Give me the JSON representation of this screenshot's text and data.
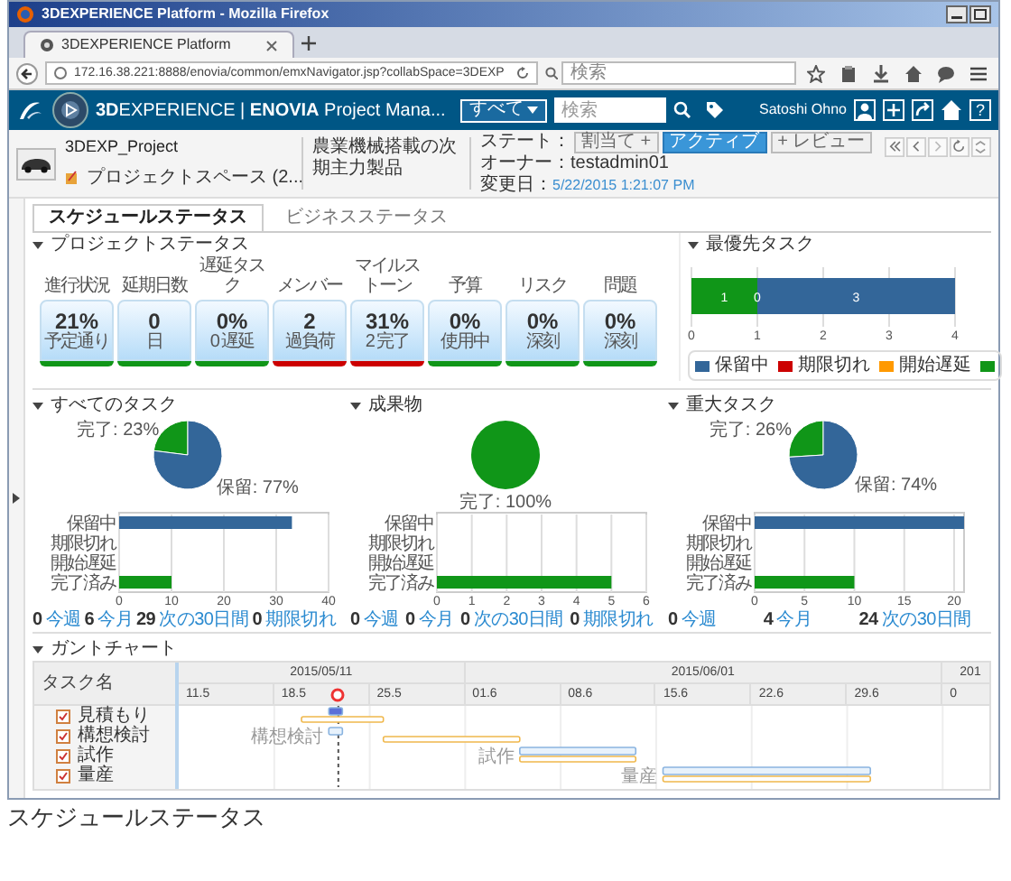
{
  "browser": {
    "title": "3DEXPERIENCE Platform - Mozilla Firefox",
    "tab": "3DEXPERIENCE Platform",
    "url": "172.16.38.221:8888/enovia/common/emxNavigator.jsp?collabSpace=3DEXP",
    "search_placeholder": "検索"
  },
  "app_bar": {
    "title": "**3D**EXPERIENCE | **ENOVIA** Project Mana...",
    "scope": "すべて",
    "search_placeholder": "検索",
    "user": "Satoshi Ohno",
    "help": "?"
  },
  "header": {
    "name": "3DEXP_Project",
    "type": "プロジェクトスペース (2...",
    "description": "農業機械搭載の次期主力製品",
    "state_label": "ステート：",
    "states": [
      {
        "label": "割当て +",
        "selected": false
      },
      {
        "label": "アクティブ",
        "selected": true
      },
      {
        "label": "+ レビュー",
        "selected": false
      }
    ],
    "owner": "オーナー：testadmin01",
    "modified_label": "変更日：",
    "modified": "5/22/2015 1:21:07 PM"
  },
  "tabs": [
    {
      "label": "スケジュールステータス",
      "selected": true
    },
    {
      "label": "ビジネスステータス",
      "selected": false
    }
  ],
  "project_status": {
    "title": "プロジェクトステータス",
    "cards": [
      {
        "label": "進行状況",
        "value": "21%",
        "note": "予定通り",
        "color": "#109618"
      },
      {
        "label": "延期日数",
        "value": "0",
        "note": "日",
        "color": "#109618"
      },
      {
        "label": "遅延タスク",
        "value": "0%",
        "note": "0 遅延",
        "color": "#109618"
      },
      {
        "label": "メンバー",
        "value": "2",
        "note": "過負荷",
        "color": "#cc0000"
      },
      {
        "label": "マイルストーン",
        "value": "31%",
        "note": "2 完了",
        "color": "#cc0000"
      },
      {
        "label": "予算",
        "value": "0%",
        "note": "使用中",
        "color": "#109618"
      },
      {
        "label": "リスク",
        "value": "0%",
        "note": "深刻",
        "color": "#109618"
      },
      {
        "label": "問題",
        "value": "0%",
        "note": "深刻",
        "color": "#109618"
      }
    ]
  },
  "top_tasks": {
    "title": "最優先タスク",
    "chart_data": {
      "type": "bar",
      "orientation": "horizontal",
      "stacked": true,
      "grid": true,
      "xlim": [
        0,
        4
      ],
      "xticks": [
        0,
        1,
        2,
        3,
        4
      ],
      "series": [
        {
          "name": "保留中",
          "color": "#336699",
          "values": [
            3
          ],
          "value_labels": [
            "3"
          ]
        },
        {
          "name": "期限切れ",
          "color": "#cc0000",
          "values": [
            null
          ]
        },
        {
          "name": "開始遅延",
          "color": "#ff9900",
          "values": [
            0
          ]
        },
        {
          "color": "#109618",
          "values": [
            1
          ],
          "value_labels": [
            "1"
          ]
        }
      ],
      "annotations": [
        {
          "x": 1,
          "text": "0"
        }
      ]
    }
  },
  "panels": [
    {
      "title": "すべてのタスク",
      "pie": {
        "chart_data": {
          "type": "pie",
          "values": [
            23,
            77
          ],
          "value_labels": [
            "完了: 23%",
            "保留: 77%"
          ]
        }
      },
      "bars": {
        "chart_data": {
          "type": "bar",
          "orientation": "horizontal",
          "grid": true,
          "categories": [
            "保留中",
            "期限切れ",
            "開始遅延",
            "完了済み"
          ],
          "values": [
            33,
            0,
            0,
            10
          ],
          "xlim": [
            0,
            40
          ],
          "xticks": [
            0,
            10,
            20,
            30,
            40
          ]
        }
      },
      "footer": [
        {
          "count": "0",
          "label": "今週"
        },
        {
          "count": "6",
          "label": "今月"
        },
        {
          "count": "29",
          "label": "次の30日間"
        },
        {
          "count": "0",
          "label": "期限切れ"
        }
      ]
    },
    {
      "title": "成果物",
      "pie": {
        "chart_data": {
          "type": "pie",
          "values": [
            100
          ],
          "value_labels": [
            "完了: 100%"
          ]
        }
      },
      "bars": {
        "chart_data": {
          "type": "bar",
          "orientation": "horizontal",
          "grid": true,
          "categories": [
            "保留中",
            "期限切れ",
            "開始遅延",
            "完了済み"
          ],
          "values": [
            0,
            0,
            0,
            5
          ],
          "xlim": [
            0,
            6
          ],
          "xticks": [
            0,
            1,
            2,
            3,
            4,
            5,
            6
          ]
        }
      },
      "footer": [
        {
          "count": "0",
          "label": "今週"
        },
        {
          "count": "0",
          "label": "今月"
        },
        {
          "count": "0",
          "label": "次の30日間"
        },
        {
          "count": "0",
          "label": "期限切れ"
        }
      ]
    },
    {
      "title": "重大タスク",
      "pie": {
        "chart_data": {
          "type": "pie",
          "values": [
            26,
            74
          ],
          "value_labels": [
            "完了: 26%",
            "保留: 74%"
          ]
        }
      },
      "bars": {
        "chart_data": {
          "type": "bar",
          "orientation": "horizontal",
          "grid": true,
          "categories": [
            "保留中",
            "期限切れ",
            "開始遅延",
            "完了済み"
          ],
          "values": [
            21,
            0,
            0,
            10
          ],
          "xlim": [
            0,
            21
          ],
          "xticks": [
            0,
            5,
            10,
            15,
            20
          ]
        }
      },
      "footer": [
        {
          "count": "0",
          "label": "今週"
        },
        {
          "count": "4",
          "label": "今月"
        },
        {
          "count": "24",
          "label": "次の30日間"
        }
      ]
    }
  ],
  "gantt": {
    "title": "ガントチャート",
    "column": "タスク名",
    "months": [
      "2015/05/11",
      "2015/06/01",
      "201"
    ],
    "days": [
      "11.5",
      "18.5",
      "25.5",
      "01.6",
      "08.6",
      "15.6",
      "22.6",
      "29.6",
      "0"
    ],
    "tasks": [
      {
        "name": "見積もり"
      },
      {
        "name": "構想検討",
        "bar_label": "構想検討"
      },
      {
        "name": "試作",
        "bar_label": "試作"
      },
      {
        "name": "量産",
        "bar_label": "量産"
      }
    ]
  },
  "caption": "スケジュールステータス"
}
